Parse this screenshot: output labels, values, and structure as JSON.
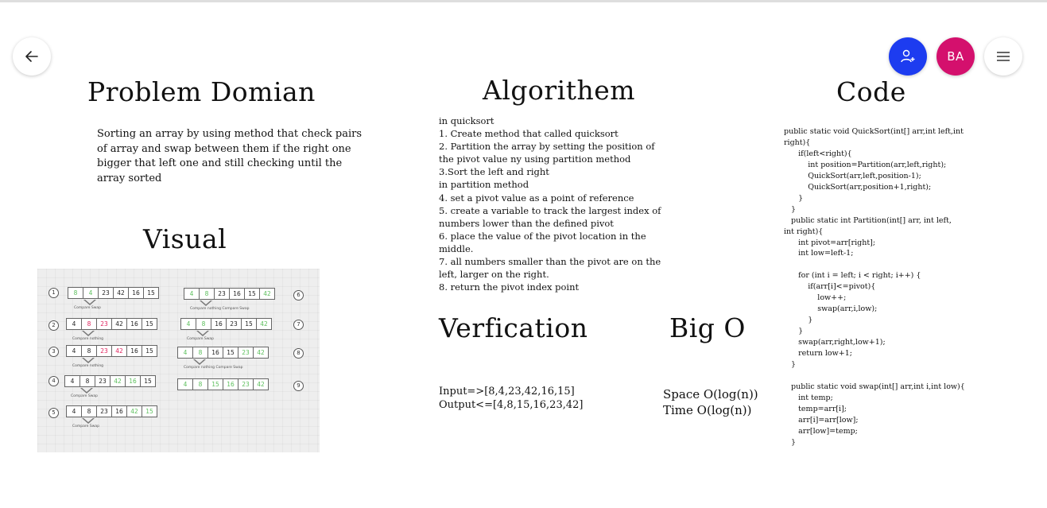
{
  "toolbar": {
    "back_icon": "arrow-left-icon",
    "share_icon": "add-person-icon",
    "avatar_initials": "BA",
    "avatar_color": "#d4106d",
    "share_color": "#1d3cf0",
    "menu_icon": "hamburger-menu-icon"
  },
  "problem": {
    "heading": "Problem Domian",
    "text": "Sorting an array by using method that check pairs of array and swap between them if the right one bigger that left one and still checking until the array sorted"
  },
  "visual": {
    "heading": "Visual",
    "steps": [
      {
        "num": "1",
        "cells": [
          "8",
          "4",
          "23",
          "42",
          "16",
          "15"
        ],
        "colors": [
          "g",
          "g",
          "",
          "",
          "",
          ""
        ],
        "caption": "Compare Swap"
      },
      {
        "num": "2",
        "cells": [
          "4",
          "8",
          "23",
          "42",
          "16",
          "15"
        ],
        "colors": [
          "",
          "r",
          "r",
          "",
          "",
          ""
        ],
        "caption": "Compare nothing"
      },
      {
        "num": "3",
        "cells": [
          "4",
          "8",
          "23",
          "42",
          "16",
          "15"
        ],
        "colors": [
          "",
          "",
          "r",
          "r",
          "",
          ""
        ],
        "caption": "Compare nothing"
      },
      {
        "num": "4",
        "cells": [
          "4",
          "8",
          "23",
          "42",
          "16",
          "15"
        ],
        "colors": [
          "",
          "",
          "",
          "g",
          "g",
          ""
        ],
        "caption": "Compare Swap"
      },
      {
        "num": "5",
        "cells": [
          "4",
          "8",
          "23",
          "16",
          "42",
          "15"
        ],
        "colors": [
          "",
          "",
          "",
          "",
          "g",
          "g"
        ],
        "caption": "Compare Swap"
      },
      {
        "num": "6",
        "cells": [
          "4",
          "8",
          "23",
          "16",
          "15",
          "42"
        ],
        "colors": [
          "g",
          "g",
          "",
          "",
          "",
          "g"
        ],
        "caption": "Compare nothing   Compare Swap"
      },
      {
        "num": "7",
        "cells": [
          "4",
          "8",
          "16",
          "23",
          "15",
          "42"
        ],
        "colors": [
          "g",
          "g",
          "",
          "",
          "",
          "g"
        ],
        "caption": "Compare Swap"
      },
      {
        "num": "8",
        "cells": [
          "4",
          "8",
          "16",
          "15",
          "23",
          "42"
        ],
        "colors": [
          "g",
          "g",
          "",
          "",
          "g",
          "g"
        ],
        "caption": "Compare nothing   Compare Swap"
      },
      {
        "num": "9",
        "cells": [
          "4",
          "8",
          "15",
          "16",
          "23",
          "42"
        ],
        "colors": [
          "g",
          "g",
          "g",
          "g",
          "g",
          "g"
        ],
        "caption": ""
      }
    ]
  },
  "algorithm": {
    "heading": "Algorithem",
    "lines": [
      "in quicksort",
      "1. Create method that called quicksort",
      "2. Partition the array by setting the position of",
      "the pivot value ny using partition method",
      "3.Sort the left and right",
      "in partition method",
      "4. set a pivot value as a point of reference",
      "5. create a variable to track the largest index of",
      "numbers lower than the defined pivot",
      "6. place the value of the pivot location in the",
      "middle.",
      "7. all numbers smaller than the pivot are on the",
      "left, larger on the right.",
      "8. return the pivot index point"
    ]
  },
  "verification": {
    "heading": "Verfication",
    "input": "Input=>[8,4,23,42,16,15]",
    "output": "Output<=[4,8,15,16,23,42]"
  },
  "bigo": {
    "heading": "Big O",
    "space": "Space O(log(n))",
    "time": "Time O(log(n))"
  },
  "code": {
    "heading": "Code",
    "lines": [
      "public static void QuickSort(int[] arr,int left,int",
      "right){",
      "      if(left<right){",
      "          int position=Partition(arr,left,right);",
      "          QuickSort(arr,left,position-1);",
      "          QuickSort(arr,position+1,right);",
      "      }",
      "   }",
      "   public static int Partition(int[] arr, int left,",
      "int right){",
      "      int pivot=arr[right];",
      "      int low=left-1;",
      "",
      "      for (int i = left; i < right; i++) {",
      "          if(arr[i]<=pivot){",
      "              low++;",
      "              swap(arr,i,low);",
      "          }",
      "      }",
      "      swap(arr,right,low+1);",
      "      return low+1;",
      "   }",
      "",
      "   public static void swap(int[] arr,int i,int low){",
      "      int temp;",
      "      temp=arr[i];",
      "      arr[i]=arr[low];",
      "      arr[low]=temp;",
      "   }"
    ]
  }
}
